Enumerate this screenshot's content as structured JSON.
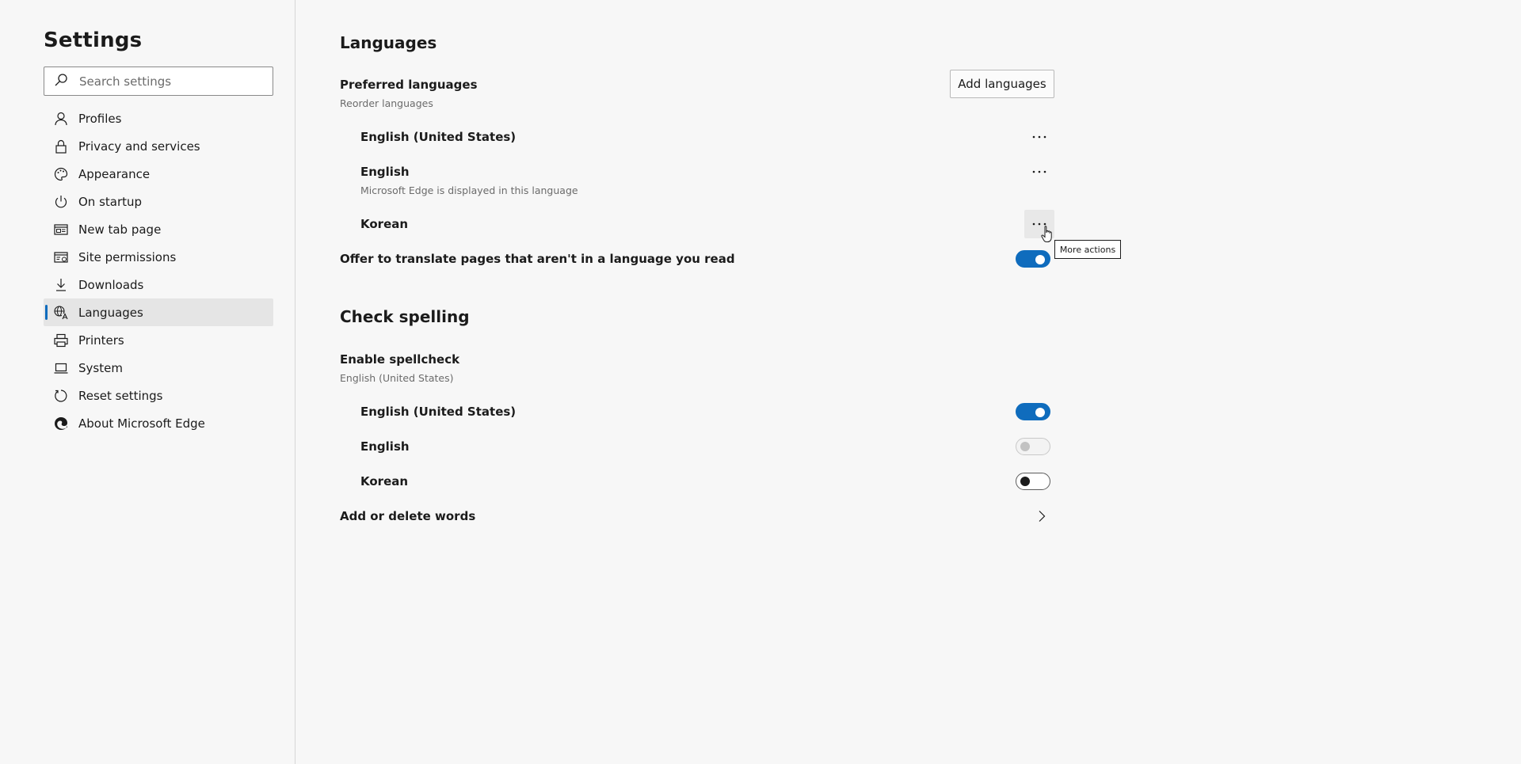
{
  "sidebar": {
    "title": "Settings",
    "search_placeholder": "Search settings",
    "items": [
      {
        "label": "Profiles",
        "icon": "person-icon"
      },
      {
        "label": "Privacy and services",
        "icon": "lock-icon"
      },
      {
        "label": "Appearance",
        "icon": "palette-icon"
      },
      {
        "label": "On startup",
        "icon": "power-icon"
      },
      {
        "label": "New tab page",
        "icon": "new-tab-icon"
      },
      {
        "label": "Site permissions",
        "icon": "site-permissions-icon"
      },
      {
        "label": "Downloads",
        "icon": "download-icon"
      },
      {
        "label": "Languages",
        "icon": "language-icon",
        "active": true
      },
      {
        "label": "Printers",
        "icon": "printer-icon"
      },
      {
        "label": "System",
        "icon": "laptop-icon"
      },
      {
        "label": "Reset settings",
        "icon": "reset-icon"
      },
      {
        "label": "About Microsoft Edge",
        "icon": "edge-logo-icon"
      }
    ]
  },
  "languages": {
    "title": "Languages",
    "preferred": {
      "title": "Preferred languages",
      "subtitle": "Reorder languages",
      "add_button": "Add languages",
      "items": [
        {
          "name": "English (United States)",
          "note": ""
        },
        {
          "name": "English",
          "note": "Microsoft Edge is displayed in this language"
        },
        {
          "name": "Korean",
          "note": ""
        }
      ]
    },
    "offer_translate": {
      "label": "Offer to translate pages that aren't in a language you read",
      "state": "on"
    }
  },
  "spelling": {
    "title": "Check spelling",
    "enable": {
      "title": "Enable spellcheck",
      "subtitle": "English (United States)"
    },
    "items": [
      {
        "name": "English (United States)",
        "state": "on"
      },
      {
        "name": "English",
        "state": "disabled"
      },
      {
        "name": "Korean",
        "state": "off"
      }
    ],
    "add_delete_words": "Add or delete words"
  },
  "tooltip": "More actions",
  "colors": {
    "accent": "#0f6cbd",
    "background": "#f7f7f7",
    "active_nav_bg": "#e5e5e5"
  }
}
